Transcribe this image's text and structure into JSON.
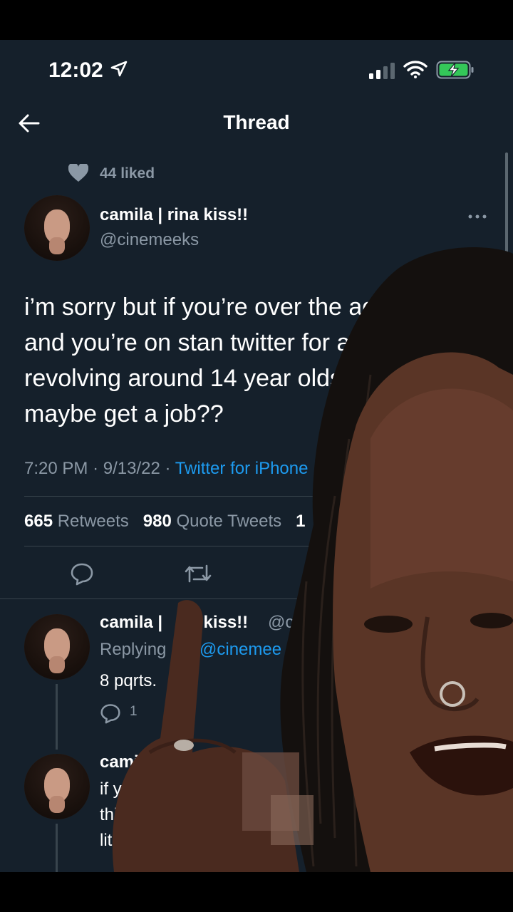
{
  "status_bar": {
    "time": "12:02",
    "icons": [
      "location-arrow-icon",
      "cellular-signal-icon",
      "wifi-icon",
      "battery-charging-icon"
    ]
  },
  "nav": {
    "back_icon": "back-arrow-icon",
    "title": "Thread"
  },
  "liked_context": {
    "icon": "heart-icon",
    "text": "44 liked"
  },
  "tweet": {
    "author_name": "camila | rina kiss!!",
    "author_handle": "@cinemeeks",
    "more_icon": "more-dots-icon",
    "text": "i’m sorry but if you’re over the age of 22 and you’re on stan twitter for a show revolving around 14 year olds… idk maybe get a job??",
    "time": "7:20 PM",
    "date": "9/13/22",
    "source": "Twitter for iPhone",
    "stats": {
      "retweets_count": "665",
      "retweets_label": "Retweets",
      "quotes_count": "980",
      "quotes_label": "Quote Tweets",
      "likes_partial": "1"
    },
    "actions": [
      "reply-icon",
      "retweet-icon"
    ]
  },
  "replies": [
    {
      "name": "camila | ",
      "name_tail": "na kiss!!",
      "handle": "@c",
      "replying_label": "Replying",
      "mention": "@cinemee",
      "text": "8 pqrts.",
      "reply_count": "1"
    },
    {
      "name": "cami",
      "line1": "if y",
      "line2": "thi",
      "line3": "lite"
    }
  ],
  "colors": {
    "background": "#15202b",
    "accent": "#1d9bf0",
    "secondary_text": "#8b98a5",
    "divider": "#38444d"
  }
}
